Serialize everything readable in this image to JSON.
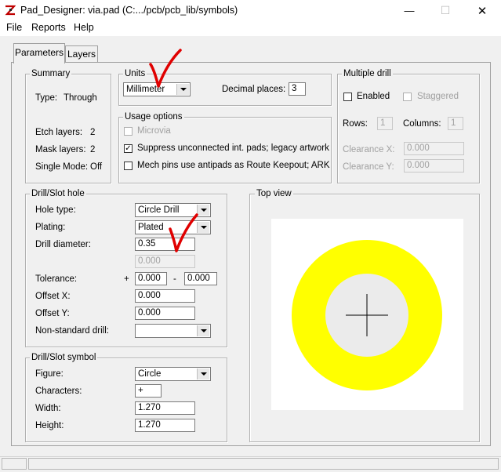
{
  "window": {
    "title": "Pad_Designer: via.pad (C:.../pcb/pcb_lib/symbols)",
    "minimize_glyph": "—",
    "maximize_glyph": "☐",
    "close_glyph": "✕"
  },
  "menu": {
    "file": "File",
    "reports": "Reports",
    "help": "Help"
  },
  "tabs": {
    "parameters": "Parameters",
    "layers": "Layers"
  },
  "summary": {
    "title": "Summary",
    "type_label": "Type:",
    "type_value": "Through",
    "etch_label": "Etch layers:",
    "etch_value": "2",
    "mask_label": "Mask layers:",
    "mask_value": "2",
    "single_label": "Single Mode:",
    "single_value": "Off"
  },
  "units": {
    "title": "Units",
    "selected": "Millimeter",
    "decimal_label": "Decimal places:",
    "decimal_value": "3"
  },
  "usage": {
    "title": "Usage options",
    "microvia": "Microvia",
    "suppress": "Suppress unconnected int. pads; legacy artwork",
    "mech": "Mech pins use antipads as Route Keepout; ARK",
    "suppress_check": "✓"
  },
  "multi_drill": {
    "title": "Multiple drill",
    "enabled": "Enabled",
    "staggered": "Staggered",
    "rows_label": "Rows:",
    "rows_value": "1",
    "columns_label": "Columns:",
    "columns_value": "1",
    "clearx_label": "Clearance X:",
    "clearx_value": "0.000",
    "cleary_label": "Clearance Y:",
    "cleary_value": "0.000"
  },
  "drill_hole": {
    "title": "Drill/Slot hole",
    "hole_type_label": "Hole type:",
    "hole_type_value": "Circle Drill",
    "plating_label": "Plating:",
    "plating_value": "Plated",
    "diameter_label": "Drill diameter:",
    "diameter_value": "0.35",
    "second_value": "0.000",
    "tolerance_label": "Tolerance:",
    "tol_plus_sign": "+",
    "tol_plus_value": "0.000",
    "tol_minus_sign": "-",
    "tol_minus_value": "0.000",
    "offx_label": "Offset X:",
    "offx_value": "0.000",
    "offy_label": "Offset Y:",
    "offy_value": "0.000",
    "nonstd_label": "Non-standard drill:",
    "nonstd_value": ""
  },
  "drill_symbol": {
    "title": "Drill/Slot symbol",
    "figure_label": "Figure:",
    "figure_value": "Circle",
    "chars_label": "Characters:",
    "chars_value": "+",
    "width_label": "Width:",
    "width_value": "1.270",
    "height_label": "Height:",
    "height_value": "1.270"
  },
  "top_view": {
    "title": "Top view"
  },
  "colors": {
    "pad": "#ffff00",
    "hole": "#ebebeb",
    "annotation": "#e00000"
  }
}
